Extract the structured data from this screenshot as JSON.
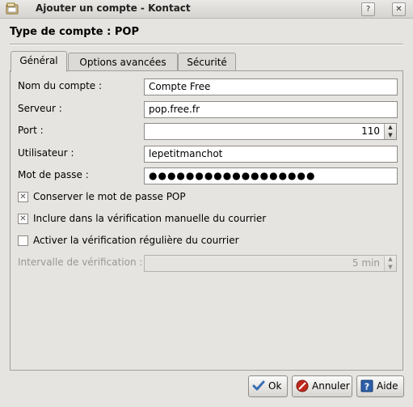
{
  "window": {
    "title": "Ajouter un compte - Kontact",
    "help_glyph": "?",
    "close_glyph": "✕"
  },
  "heading": "Type de compte : POP",
  "tabs": [
    {
      "label": "Général",
      "active": true
    },
    {
      "label": "Options avancées",
      "active": false
    },
    {
      "label": "Sécurité",
      "active": false
    }
  ],
  "form": {
    "account_name": {
      "label": "Nom du compte :",
      "value": "Compte Free"
    },
    "server": {
      "label": "Serveur :",
      "value": "pop.free.fr"
    },
    "port": {
      "label": "Port :",
      "value": "110"
    },
    "user": {
      "label": "Utilisateur :",
      "value": "lepetitmanchot"
    },
    "password": {
      "label": "Mot de passe :",
      "value": "●●●●●●●●●●●●●●●●●●"
    },
    "keep_password": {
      "label": "Conserver le mot de passe POP",
      "checked": true
    },
    "include_manual": {
      "label": "Inclure dans la vérification manuelle du courrier",
      "checked": true
    },
    "periodic_check": {
      "label": "Activer la vérification régulière du courrier",
      "checked": false
    },
    "interval": {
      "label": "Intervalle de vérification :",
      "value": "5 min",
      "disabled": true
    }
  },
  "buttons": {
    "ok": "Ok",
    "cancel": "Annuler",
    "help": "Aide"
  },
  "icons": {
    "app": "kontact-app-icon",
    "ok": "checkmark-icon",
    "cancel": "cancel-icon",
    "help": "help-book-icon"
  },
  "colors": {
    "window_bg": "#e6e4e0",
    "ok_icon": "#3a6db5",
    "cancel_icon": "#c0281c",
    "help_icon": "#2d5fa8"
  }
}
